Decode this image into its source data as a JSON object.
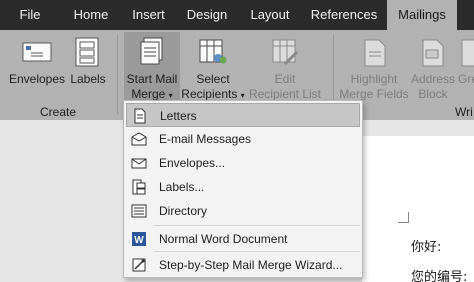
{
  "tabs": [
    {
      "label": "File",
      "active": false
    },
    {
      "label": "Home",
      "active": false
    },
    {
      "label": "Insert",
      "active": false
    },
    {
      "label": "Design",
      "active": false
    },
    {
      "label": "Layout",
      "active": false
    },
    {
      "label": "References",
      "active": false
    },
    {
      "label": "Mailings",
      "active": true
    }
  ],
  "ribbon": {
    "envelopes": "Envelopes",
    "labels": "Labels",
    "start_line1": "Start Mail",
    "start_line2": "Merge",
    "select_line1": "Select",
    "select_line2": "Recipients",
    "edit_line1": "Edit",
    "edit_line2": "Recipient List",
    "highlight_line1": "Highlight",
    "highlight_line2": "Merge Fields",
    "address_line1": "Address",
    "address_line2": "Block",
    "greeting_fragment": "Gre",
    "group_create": "Create",
    "group_write_fragment": "Wri"
  },
  "menu": {
    "items": [
      {
        "label": "Letters",
        "icon": "letters-icon"
      },
      {
        "label": "E-mail Messages",
        "icon": "email-icon"
      },
      {
        "label": "Envelopes...",
        "icon": "envelope-icon"
      },
      {
        "label": "Labels...",
        "icon": "labels-icon"
      },
      {
        "label": "Directory",
        "icon": "directory-icon"
      },
      {
        "label": "Normal Word Document",
        "icon": "word-icon"
      },
      {
        "label": "Step-by-Step Mail Merge Wizard...",
        "icon": "wizard-icon"
      }
    ]
  },
  "document": {
    "line1": "你好:",
    "line2": "您的编号:"
  },
  "colors": {
    "tab_bar": "#2b2b2b",
    "ribbon": "#b2b2b2",
    "highlight": "#c6c6c6",
    "word_blue": "#2b579a"
  }
}
